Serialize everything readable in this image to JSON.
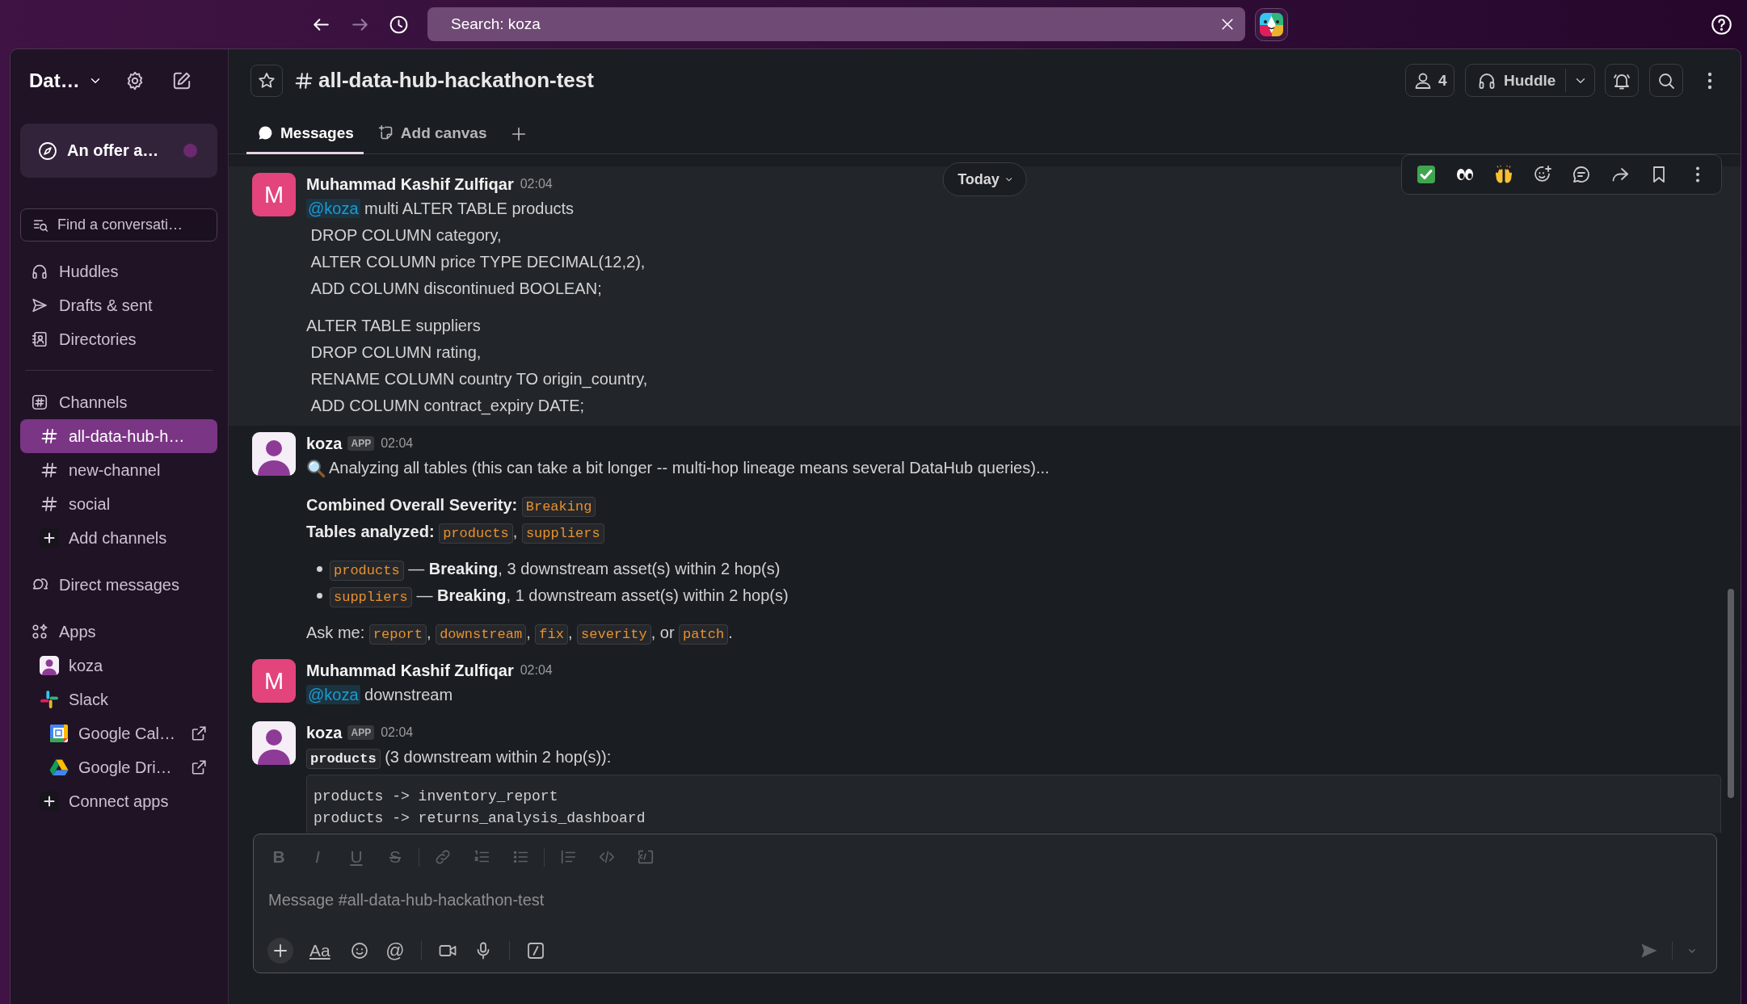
{
  "top_bar": {
    "back": {
      "disabled": false
    },
    "forward": {
      "disabled": true
    },
    "search": {
      "text": "Search: koza"
    }
  },
  "sidebar": {
    "workspace": "Dat…",
    "promo": {
      "text": "An offer a…",
      "unread": true
    },
    "search": {
      "placeholder": "Find a conversati…"
    },
    "nav": [
      {
        "label": "Huddles",
        "kind": "huddles"
      },
      {
        "label": "Drafts & sent",
        "kind": "drafts"
      },
      {
        "label": "Directories",
        "kind": "directories"
      }
    ],
    "channels": {
      "title": "Channels",
      "items": [
        {
          "name": "all-data-hub-h…",
          "selected": true
        },
        {
          "name": "new-channel",
          "selected": false
        },
        {
          "name": "social",
          "selected": false
        }
      ],
      "add": "Add channels"
    },
    "direct_messages": {
      "title": "Direct messages"
    },
    "apps": {
      "title": "Apps",
      "items": [
        {
          "name": "koza",
          "kind": "bot"
        },
        {
          "name": "Slack",
          "kind": "app"
        },
        {
          "name": "Google Cal…",
          "kind": "calendar"
        },
        {
          "name": "Google Dri…",
          "kind": "drive"
        }
      ],
      "add": "Connect apps"
    }
  },
  "channel_header": {
    "starred": false,
    "channel": "all-data-hub-hackathon-test",
    "members": "4",
    "huddle": "Huddle"
  },
  "tabs": [
    {
      "label": "Messages",
      "kind": "messages",
      "selected": true
    },
    {
      "label": "Add canvas",
      "kind": "canvas",
      "selected": false
    }
  ],
  "date_divider": "Today",
  "messages": [
    {
      "kind": "user",
      "author": "Muhammad Kashif Zulfiqar",
      "avatar": "M",
      "time": "02:04",
      "hovered": true,
      "blocks": [
        {
          "kind": "paragraph",
          "lines": [
            [
              {
                "kind": "mention",
                "text": "@koza"
              },
              {
                "kind": "text",
                "text": " multi ALTER TABLE products"
              }
            ],
            " DROP COLUMN category,",
            " ALTER COLUMN price TYPE DECIMAL(12,2),",
            " ADD COLUMN discontinued BOOLEAN;"
          ]
        },
        {
          "kind": "paragraph",
          "lines": [
            "ALTER TABLE suppliers",
            " DROP COLUMN rating,",
            " RENAME COLUMN country TO origin_country,",
            " ADD COLUMN contract_expiry DATE;"
          ]
        }
      ]
    },
    {
      "kind": "bot",
      "author": "koza",
      "badge": "APP",
      "time": "02:04",
      "hovered": false,
      "blocks": [
        {
          "kind": "status",
          "text": "Analyzing all tables (this can take a bit longer -- multi-hop lineage means several DataHub queries)..."
        },
        {
          "kind": "paragraph",
          "lines": [
            [
              {
                "kind": "text",
                "text": "**Combined Overall Severity:** "
              },
              {
                "kind": "code",
                "text": "Breaking"
              }
            ],
            [
              {
                "kind": "text",
                "text": "**Tables analyzed:** "
              },
              {
                "kind": "code",
                "text": "products"
              },
              {
                "kind": "text",
                "text": ", "
              },
              {
                "kind": "code",
                "text": "suppliers"
              }
            ]
          ]
        },
        {
          "kind": "bullets",
          "items": [
            [
              {
                "kind": "code",
                "text": "products"
              },
              {
                "kind": "text",
                "text": " — **Breaking**, 3 downstream asset(s) within 2 hop(s)"
              }
            ],
            [
              {
                "kind": "code",
                "text": "suppliers"
              },
              {
                "kind": "text",
                "text": " — **Breaking**, 1 downstream asset(s) within 2 hop(s)"
              }
            ]
          ]
        },
        {
          "kind": "paragraph",
          "lines": [
            [
              {
                "kind": "text",
                "text": "Ask me: "
              },
              {
                "kind": "code",
                "text": "report"
              },
              {
                "kind": "text",
                "text": ", "
              },
              {
                "kind": "code",
                "text": "downstream"
              },
              {
                "kind": "text",
                "text": ", "
              },
              {
                "kind": "code",
                "text": "fix"
              },
              {
                "kind": "text",
                "text": ", "
              },
              {
                "kind": "code",
                "text": "severity"
              },
              {
                "kind": "text",
                "text": ", or "
              },
              {
                "kind": "code",
                "text": "patch"
              },
              {
                "kind": "text",
                "text": "."
              }
            ]
          ]
        }
      ]
    },
    {
      "kind": "user",
      "author": "Muhammad Kashif Zulfiqar",
      "avatar": "M",
      "time": "02:04",
      "hovered": false,
      "blocks": [
        {
          "kind": "paragraph",
          "lines": [
            [
              {
                "kind": "mention",
                "text": "@koza"
              },
              {
                "kind": "text",
                "text": " downstream"
              }
            ]
          ]
        }
      ]
    },
    {
      "kind": "bot",
      "author": "koza",
      "badge": "APP",
      "time": "02:04",
      "hovered": false,
      "blocks": [
        {
          "kind": "paragraph",
          "lines": [
            [
              {
                "kind": "code",
                "text": "**products**"
              },
              {
                "kind": "text",
                "text": " (3 downstream within 2 hop(s)):"
              }
            ]
          ]
        },
        {
          "kind": "code_block",
          "lines": [
            "products -> inventory_report",
            "products -> returns_analysis_dashboard"
          ]
        }
      ]
    }
  ],
  "composer": {
    "formatting": [
      {
        "label": "B",
        "kind": "bold"
      },
      {
        "label": "I",
        "kind": "italic"
      },
      {
        "label": "U",
        "kind": "underline"
      },
      {
        "label": "S",
        "kind": "strike"
      }
    ],
    "placeholder": "Message #all-data-hub-hackathon-test",
    "format_button": "Aa",
    "mention_button": "@"
  }
}
